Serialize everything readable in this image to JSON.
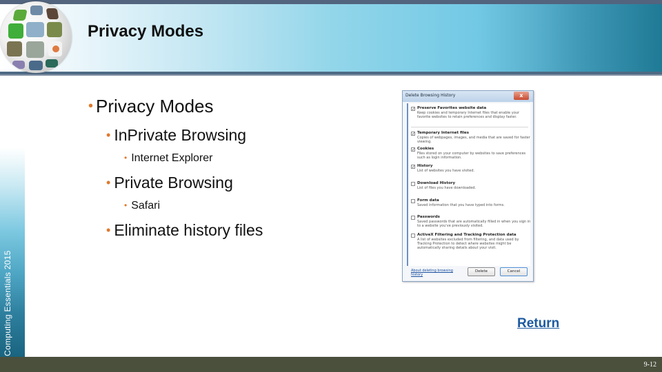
{
  "header": {
    "title": "Privacy Modes",
    "logo": "globe-photo-collage-icon"
  },
  "sidebar": {
    "text": "Computing Essentials 2015"
  },
  "bullets": [
    {
      "level": 1,
      "text": "Privacy Modes"
    },
    {
      "level": 2,
      "text": "InPrivate Browsing"
    },
    {
      "level": 3,
      "text": "Internet Explorer"
    },
    {
      "level": 2,
      "text": "Private Browsing"
    },
    {
      "level": 3,
      "text": "Safari"
    },
    {
      "level": 2,
      "text": "Eliminate history files"
    }
  ],
  "bullet_glyph": "•",
  "dialog": {
    "title": "Delete Browsing History",
    "close_label": "x",
    "items": [
      {
        "title": "Preserve Favorites website data",
        "desc": "Keep cookies and temporary Internet files that enable your favorite websites to retain preferences and display faster.",
        "checked": true
      },
      {
        "title": "Temporary Internet files",
        "desc": "Copies of webpages, images, and media that are saved for faster viewing.",
        "checked": true
      },
      {
        "title": "Cookies",
        "desc": "Files stored on your computer by websites to save preferences such as login information.",
        "checked": true
      },
      {
        "title": "History",
        "desc": "List of websites you have visited.",
        "checked": true
      },
      {
        "title": "Download History",
        "desc": "List of files you have downloaded.",
        "checked": false
      },
      {
        "title": "Form data",
        "desc": "Saved information that you have typed into forms.",
        "checked": false
      },
      {
        "title": "Passwords",
        "desc": "Saved passwords that are automatically filled in when you sign in to a website you've previously visited.",
        "checked": false
      },
      {
        "title": "ActiveX Filtering and Tracking Protection data",
        "desc": "A list of websites excluded from filtering, and data used by Tracking Protection to detect where websites might be automatically sharing details about your visit.",
        "checked": false
      }
    ],
    "link": "About deleting browsing history",
    "delete_label": "Delete",
    "cancel_label": "Cancel",
    "check_glyph": "✓"
  },
  "return_link": "Return",
  "footer": {
    "page_number": "9-12"
  },
  "colors": {
    "bullet": "#e0782c",
    "footer": "#4a503c",
    "link": "#1c5aa0"
  }
}
